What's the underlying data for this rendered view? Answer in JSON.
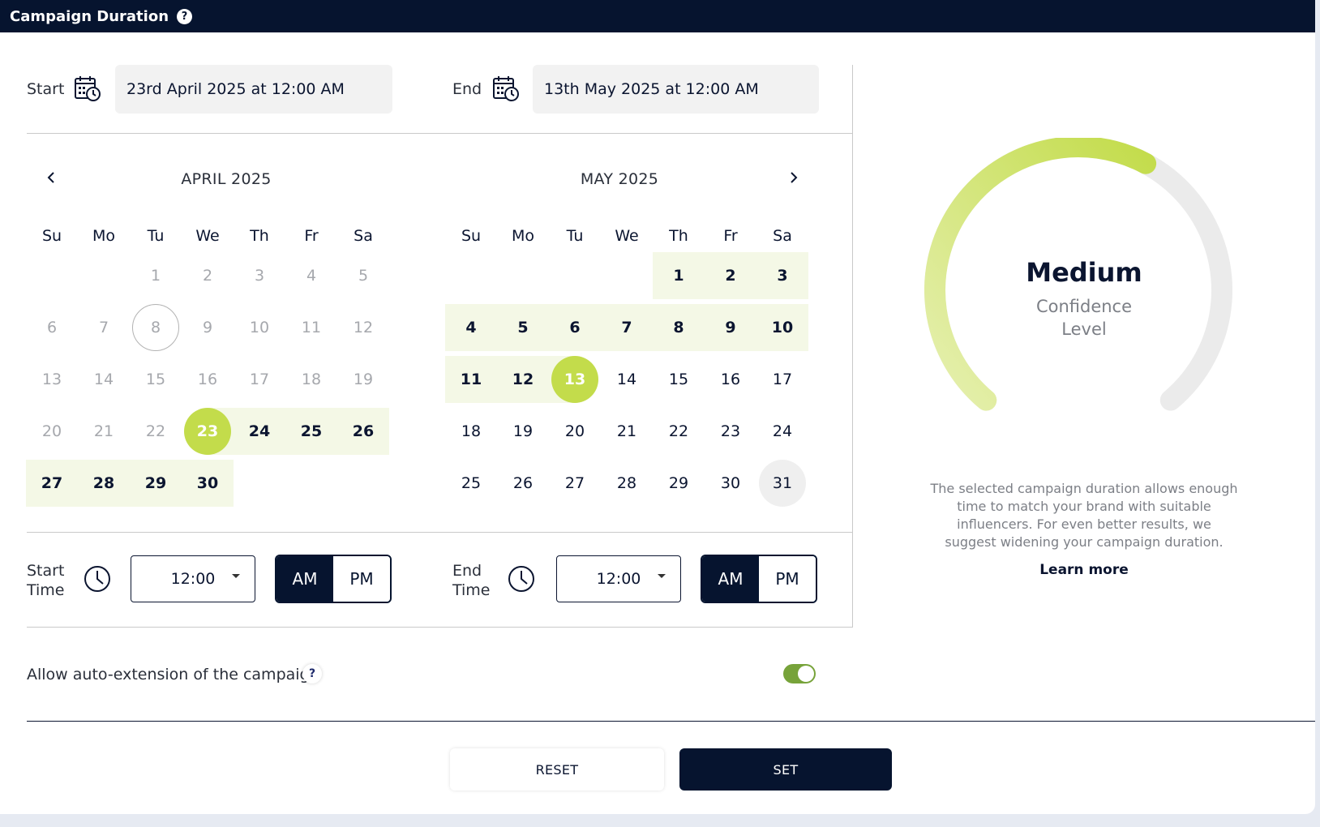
{
  "header": {
    "title": "Campaign Duration",
    "help": "?"
  },
  "start": {
    "label": "Start",
    "value": "23rd April 2025 at 12:00 AM"
  },
  "end": {
    "label": "End",
    "value": "13th May 2025 at 12:00 AM"
  },
  "weekdays": [
    "Su",
    "Mo",
    "Tu",
    "We",
    "Th",
    "Fr",
    "Sa"
  ],
  "calendars": [
    {
      "title": "APRIL 2025",
      "first_weekday": 2,
      "days_in_month": 30,
      "selected": 23,
      "range_start": 23,
      "range_end": 30,
      "past_before": 23,
      "outlined_day": 8,
      "hover_day": null
    },
    {
      "title": "MAY 2025",
      "first_weekday": 4,
      "days_in_month": 31,
      "selected": 13,
      "range_start": 1,
      "range_end": 13,
      "past_before": 0,
      "outlined_day": null,
      "hover_day": 31
    }
  ],
  "start_time": {
    "label_line1": "Start",
    "label_line2": "Time",
    "value": "12:00",
    "am": "AM",
    "pm": "PM",
    "active": "AM"
  },
  "end_time": {
    "label_line1": "End",
    "label_line2": "Time",
    "value": "12:00",
    "am": "AM",
    "pm": "PM",
    "active": "AM"
  },
  "auto_extension": {
    "label": "Allow auto-extension of the campaign",
    "help": "?",
    "enabled": true
  },
  "buttons": {
    "reset": "RESET",
    "set": "SET"
  },
  "confidence": {
    "level": "Medium",
    "subtitle_line1": "Confidence",
    "subtitle_line2": "Level",
    "fill_fraction": 0.6,
    "description": "The selected campaign duration allows enough time to match your brand with suitable influencers. For even better results, we suggest widening your campaign duration.",
    "learn_more": "Learn more"
  },
  "colors": {
    "navy": "#06142f",
    "lime": "#c3dc4b",
    "range_bg": "#f4f8e6",
    "toggle_on": "#77a33a"
  }
}
